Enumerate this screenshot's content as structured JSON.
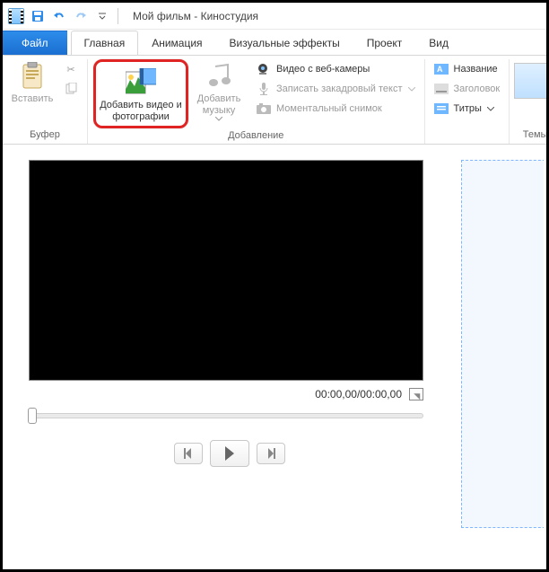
{
  "title": "Мой фильм - Киностудия",
  "qat": {
    "save_tip": "Сохранить",
    "undo_tip": "Отменить",
    "redo_tip": "Вернуть"
  },
  "tabs": {
    "file": "Файл",
    "home": "Главная",
    "anim": "Анимация",
    "vfx": "Визуальные эффекты",
    "project": "Проект",
    "view": "Вид"
  },
  "ribbon": {
    "buffer": {
      "paste": "Вставить",
      "group": "Буфер"
    },
    "add": {
      "add_media": "Добавить видео и фотографии",
      "add_music": "Добавить музыку",
      "webcam": "Видео с веб-камеры",
      "narration": "Записать закадровый текст",
      "snapshot": "Моментальный снимок",
      "group": "Добавление"
    },
    "text": {
      "title": "Название",
      "caption": "Заголовок",
      "credits": "Титры"
    },
    "themes": {
      "group": "Темы а"
    }
  },
  "preview": {
    "time": "00:00,00/00:00,00"
  }
}
